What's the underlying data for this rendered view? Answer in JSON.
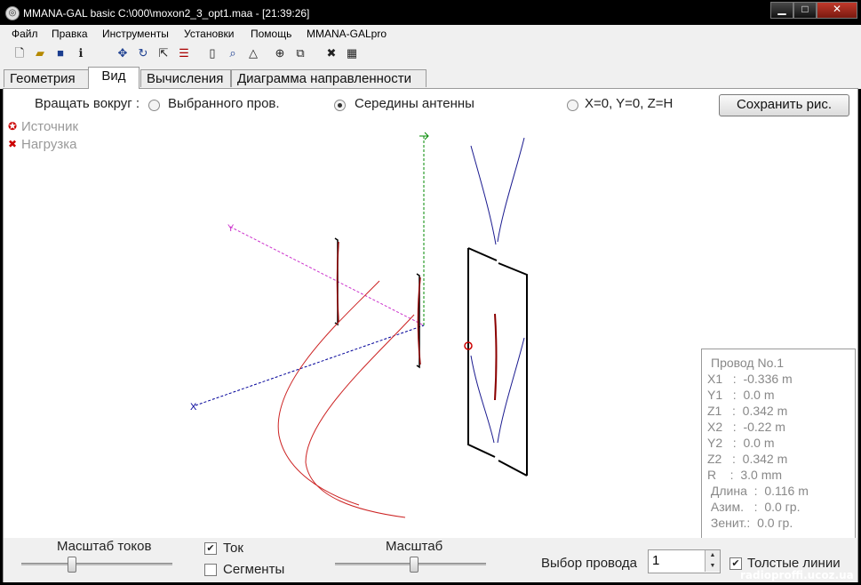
{
  "window": {
    "title": "MMANA-GAL basic C:\\000\\moxon2_3_opt1.maa - [21:39:26]",
    "min_glyph": "▁",
    "max_glyph": "□",
    "close_glyph": "✕"
  },
  "menu": [
    "Файл",
    "Правка",
    "Инструменты",
    "Установки",
    "Помощь",
    "MMANA-GALpro"
  ],
  "toolbar_icons": [
    "new-icon",
    "open-icon",
    "save-icon",
    "info-icon",
    "move-icon",
    "rotate-icon",
    "resize-icon",
    "wire-edit-icon",
    "doc-icon",
    "loupe-icon",
    "triangle-icon",
    "target-icon",
    "copy-icon",
    "tools-icon",
    "calculator-icon"
  ],
  "tabs": [
    "Геометрия",
    "Вид",
    "Вычисления",
    "Диаграмма направленности"
  ],
  "active_tab": "Вид",
  "view": {
    "rotate_label": "Вращать вокруг :",
    "options": [
      "Выбранного пров.",
      "Середины антенны",
      "X=0, Y=0, Z=H"
    ],
    "selected_option": "Середины антенны",
    "save_button": "Сохранить рис.",
    "legend": [
      {
        "label": "Источник",
        "marker": "source-marker-icon",
        "color": "#cc0000"
      },
      {
        "label": "Нагрузка",
        "marker": "load-marker-icon",
        "color": "#cc0000"
      }
    ],
    "axis_labels": {
      "x": "Y",
      "y": "X",
      "z": "Z"
    },
    "colors": {
      "wire": "#000000",
      "current": "#8b0000",
      "projection": "#00008b",
      "x_axis": "#cc33cc",
      "y_axis": "#000099",
      "z_axis": "#008800"
    }
  },
  "wire_info": {
    "title": "Провод No.1",
    "lines": [
      "X1   :  -0.336 m",
      "Y1   :  0.0 m",
      "Z1   :  0.342 m",
      "X2   :  -0.22 m",
      "Y2   :  0.0 m",
      "Z2   :  0.342 m",
      "R    :  3.0 mm",
      " Длина  :  0.116 m",
      " Азим.   :  0.0 гр.",
      " Зенит.:  0.0 гр."
    ]
  },
  "bottom": {
    "current_scale_label": "Масштаб токов",
    "current_scale_pos": 0.33,
    "current_label": "Ток",
    "current_checked": true,
    "segments_label": "Сегменты",
    "segments_checked": false,
    "scale_label": "Масштаб",
    "scale_pos": 0.52,
    "wire_select_label": "Выбор провода",
    "wire_select_value": "1",
    "thick_lines_label": "Толстые линии",
    "thick_lines_checked": true
  },
  "watermark": "radioproffi.ucoz.ua"
}
